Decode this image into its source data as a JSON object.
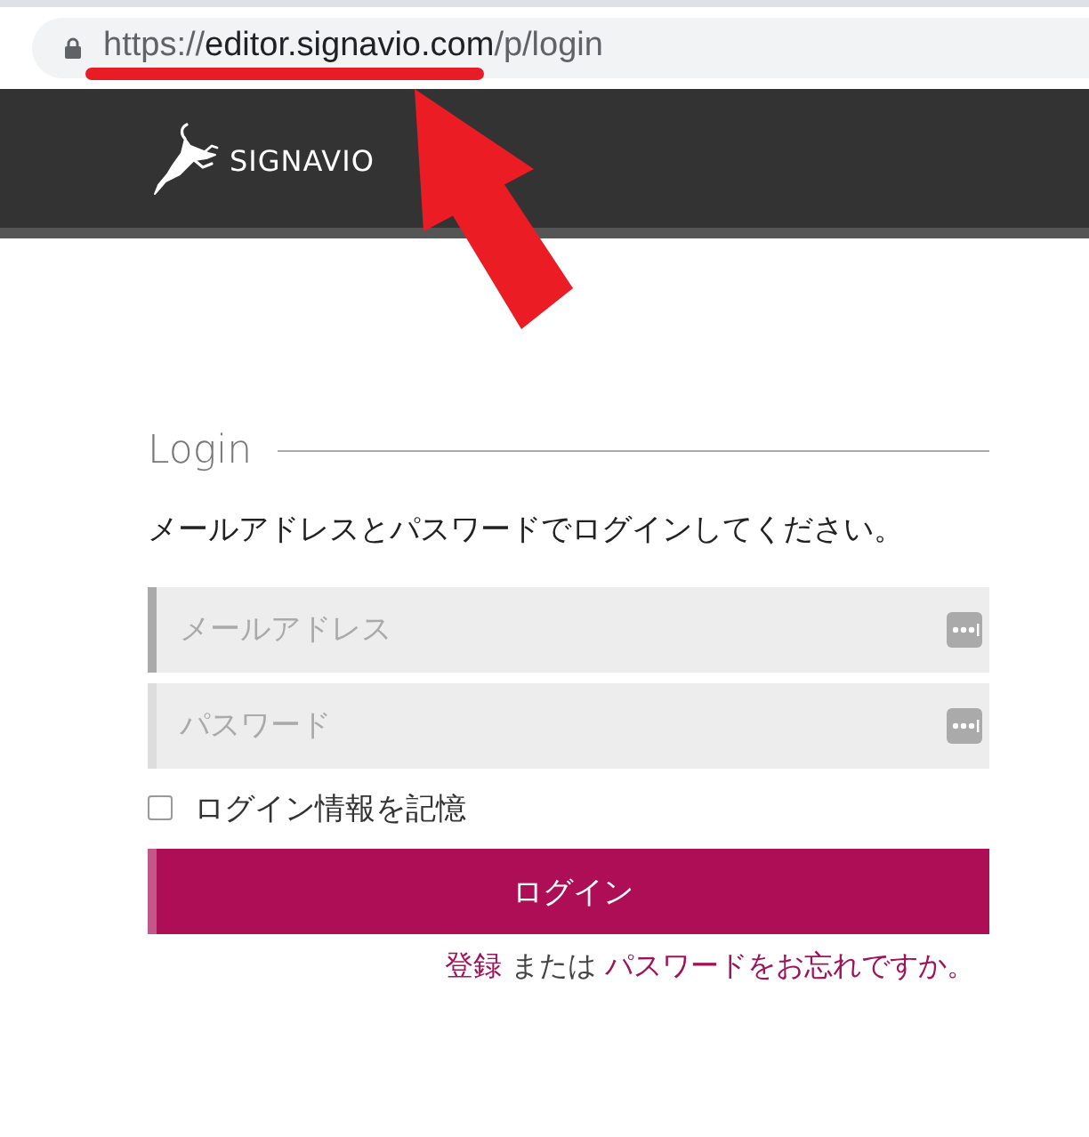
{
  "browser": {
    "url": {
      "scheme": "https://",
      "host": "editor.signavio.com",
      "path": "/p/login"
    }
  },
  "header": {
    "logo_text": "SIGNAVIO"
  },
  "login": {
    "title": "Login",
    "instruction": "メールアドレスとパスワードでログインしてください。",
    "fields": [
      {
        "placeholder": "メールアドレス",
        "focused": true
      },
      {
        "placeholder": "パスワード",
        "focused": false
      }
    ],
    "remember": {
      "label": "ログイン情報を記憶",
      "checked": false
    },
    "submit": "ログイン",
    "links": [
      {
        "kind": "link",
        "text": "登録"
      },
      {
        "kind": "plain",
        "text": "または"
      },
      {
        "kind": "link",
        "text": "パスワードをお忘れですか。"
      }
    ]
  }
}
